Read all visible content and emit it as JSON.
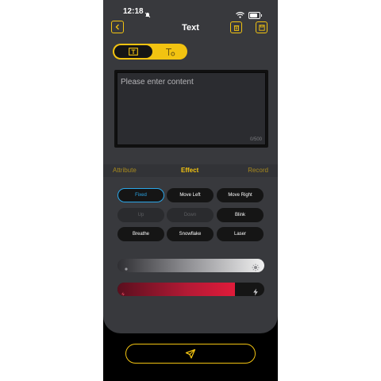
{
  "status_bar": {
    "time": "12:18"
  },
  "header": {
    "title": "Text"
  },
  "editor": {
    "placeholder": "Please enter content",
    "counter": "0/500"
  },
  "tabs": [
    {
      "label": "Attribute",
      "active": false
    },
    {
      "label": "Effect",
      "active": true
    },
    {
      "label": "Record",
      "active": false
    }
  ],
  "effects": [
    {
      "label": "Fixed",
      "state": "selected"
    },
    {
      "label": "Move Left",
      "state": "enabled"
    },
    {
      "label": "Move Right",
      "state": "enabled"
    },
    {
      "label": "Up",
      "state": "disabled"
    },
    {
      "label": "Down",
      "state": "disabled"
    },
    {
      "label": "Blink",
      "state": "enabled"
    },
    {
      "label": "Breathe",
      "state": "enabled"
    },
    {
      "label": "Snowflake",
      "state": "enabled"
    },
    {
      "label": "Laser",
      "state": "enabled"
    }
  ],
  "sliders": {
    "brightness_level": 1.0,
    "speed_level": 0.8
  },
  "colors": {
    "accent": "#f2c311",
    "selected": "#2aa6e8",
    "speed_fill": "#e01b3a",
    "panel": "#38393d"
  }
}
